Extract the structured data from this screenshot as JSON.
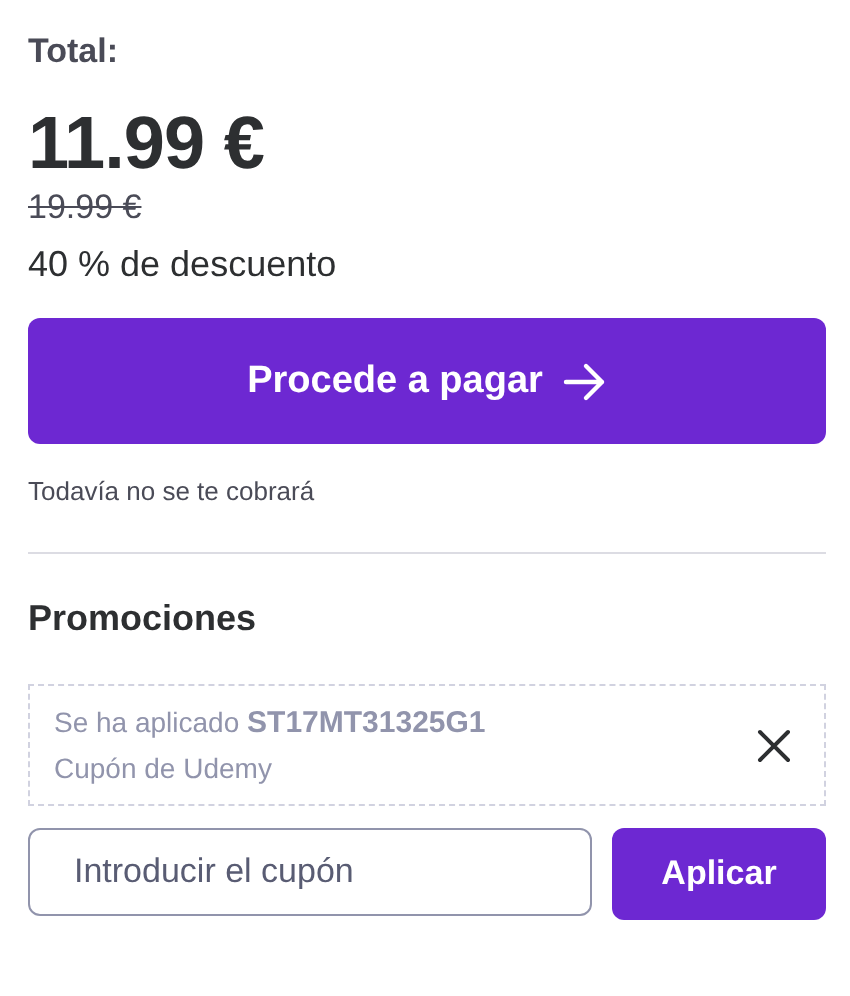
{
  "total_label": "Total:",
  "price": "11.99 €",
  "original_price": "19.99 €",
  "discount": "40 % de descuento",
  "checkout_button": "Procede a pagar",
  "note": "Todavía no se te cobrará",
  "promotions": {
    "title": "Promociones",
    "applied_coupon": {
      "text": "Se ha aplicado **ST17MT31325G1**",
      "source": "Cupón de Udemy"
    },
    "coupon_field": {
      "placeholder": "Introducir el cupón"
    },
    "apply_button": "Aplicar"
  }
}
